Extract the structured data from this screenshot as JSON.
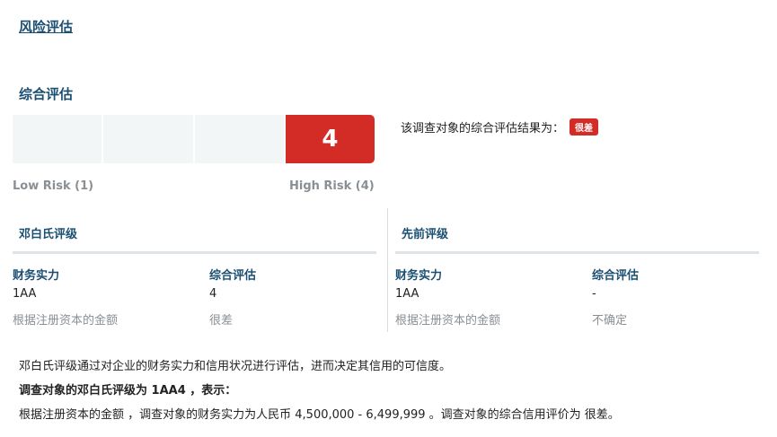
{
  "page_link": "风险评估",
  "section_title": "综合评估",
  "scale": {
    "segments": [
      "",
      "",
      "",
      "4"
    ],
    "active_index": 3,
    "active_value": "4"
  },
  "result": {
    "text": "该调查对象的综合评估结果为：",
    "badge": "很差"
  },
  "risk_labels": {
    "low": "Low Risk (1)",
    "high": "High Risk (4)"
  },
  "dnb_panel": {
    "title": "邓白氏评级",
    "headers": [
      "财务实力",
      "综合评估"
    ],
    "values": [
      "1AA",
      "4"
    ],
    "subs": [
      "根据注册资本的金额",
      "很差"
    ]
  },
  "prev_panel": {
    "title": "先前评级",
    "headers": [
      "财务实力",
      "综合评估"
    ],
    "values": [
      "1AA",
      "-"
    ],
    "subs": [
      "根据注册资本的金额",
      "不确定"
    ]
  },
  "description": {
    "line1": "邓白氏评级通过对企业的财务实力和信用状况进行评估，进而决定其信用的可信度。",
    "line2": "调查对象的邓白氏评级为 1AA4 ，表示：",
    "line3": "根据注册资本的金额 ，调查对象的财务实力为人民币 4,500,000 - 6,499,999 。调查对象的综合信用评价为 很差。"
  },
  "colors": {
    "accent": "#1b4f72",
    "danger": "#d32b26",
    "muted": "#8a8f94",
    "segment_bg": "#f3f6f6"
  }
}
